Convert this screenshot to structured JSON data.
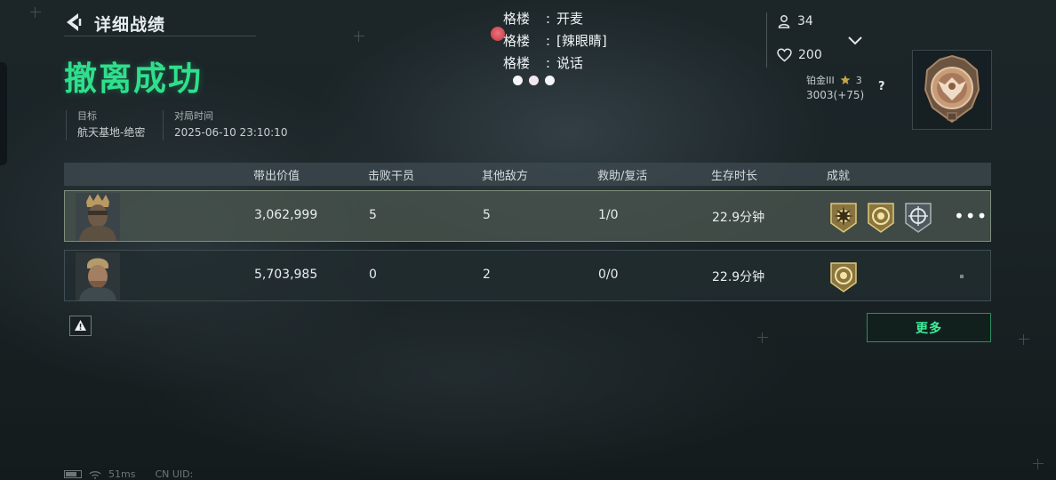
{
  "header": {
    "title": "详细战绩",
    "result": "撤离成功"
  },
  "meta": {
    "target_label": "目标",
    "target_value": "航天基地-绝密",
    "time_label": "对局时间",
    "time_value": "2025-06-10 23:10:10"
  },
  "teammates": [
    {
      "name": "格楼",
      "status": "开麦"
    },
    {
      "name": "格楼",
      "status": "[辣眼睛]"
    },
    {
      "name": "格楼",
      "status": "说话"
    }
  ],
  "profile": {
    "followers": "34",
    "likes": "200",
    "rank_name": "铂金III",
    "rank_stars": "3",
    "rank_points": "3003(+75)",
    "help": "?"
  },
  "table": {
    "headers": [
      "带出价值",
      "击败干员",
      "其他敌方",
      "救助/复活",
      "生存时长",
      "成就"
    ],
    "rows": [
      {
        "value": "3,062,999",
        "kills": "5",
        "other": "5",
        "assist": "1/0",
        "survival": "22.9分钟"
      },
      {
        "value": "5,703,985",
        "kills": "0",
        "other": "2",
        "assist": "0/0",
        "survival": "22.9分钟"
      }
    ]
  },
  "buttons": {
    "more": "更多",
    "row_menu": "•••"
  },
  "status_bar": {
    "ping": "51ms",
    "uid": "CN UID:"
  },
  "icons": {
    "back": "back-arrow-icon",
    "followers": "person-icon",
    "likes": "heart-icon",
    "expand": "chevron-down-icon",
    "warning": "warning-icon",
    "star": "star-icon"
  },
  "colors": {
    "accent_green": "#2ee08c",
    "button_green": "#3ef09a",
    "gold": "#c9a548"
  }
}
